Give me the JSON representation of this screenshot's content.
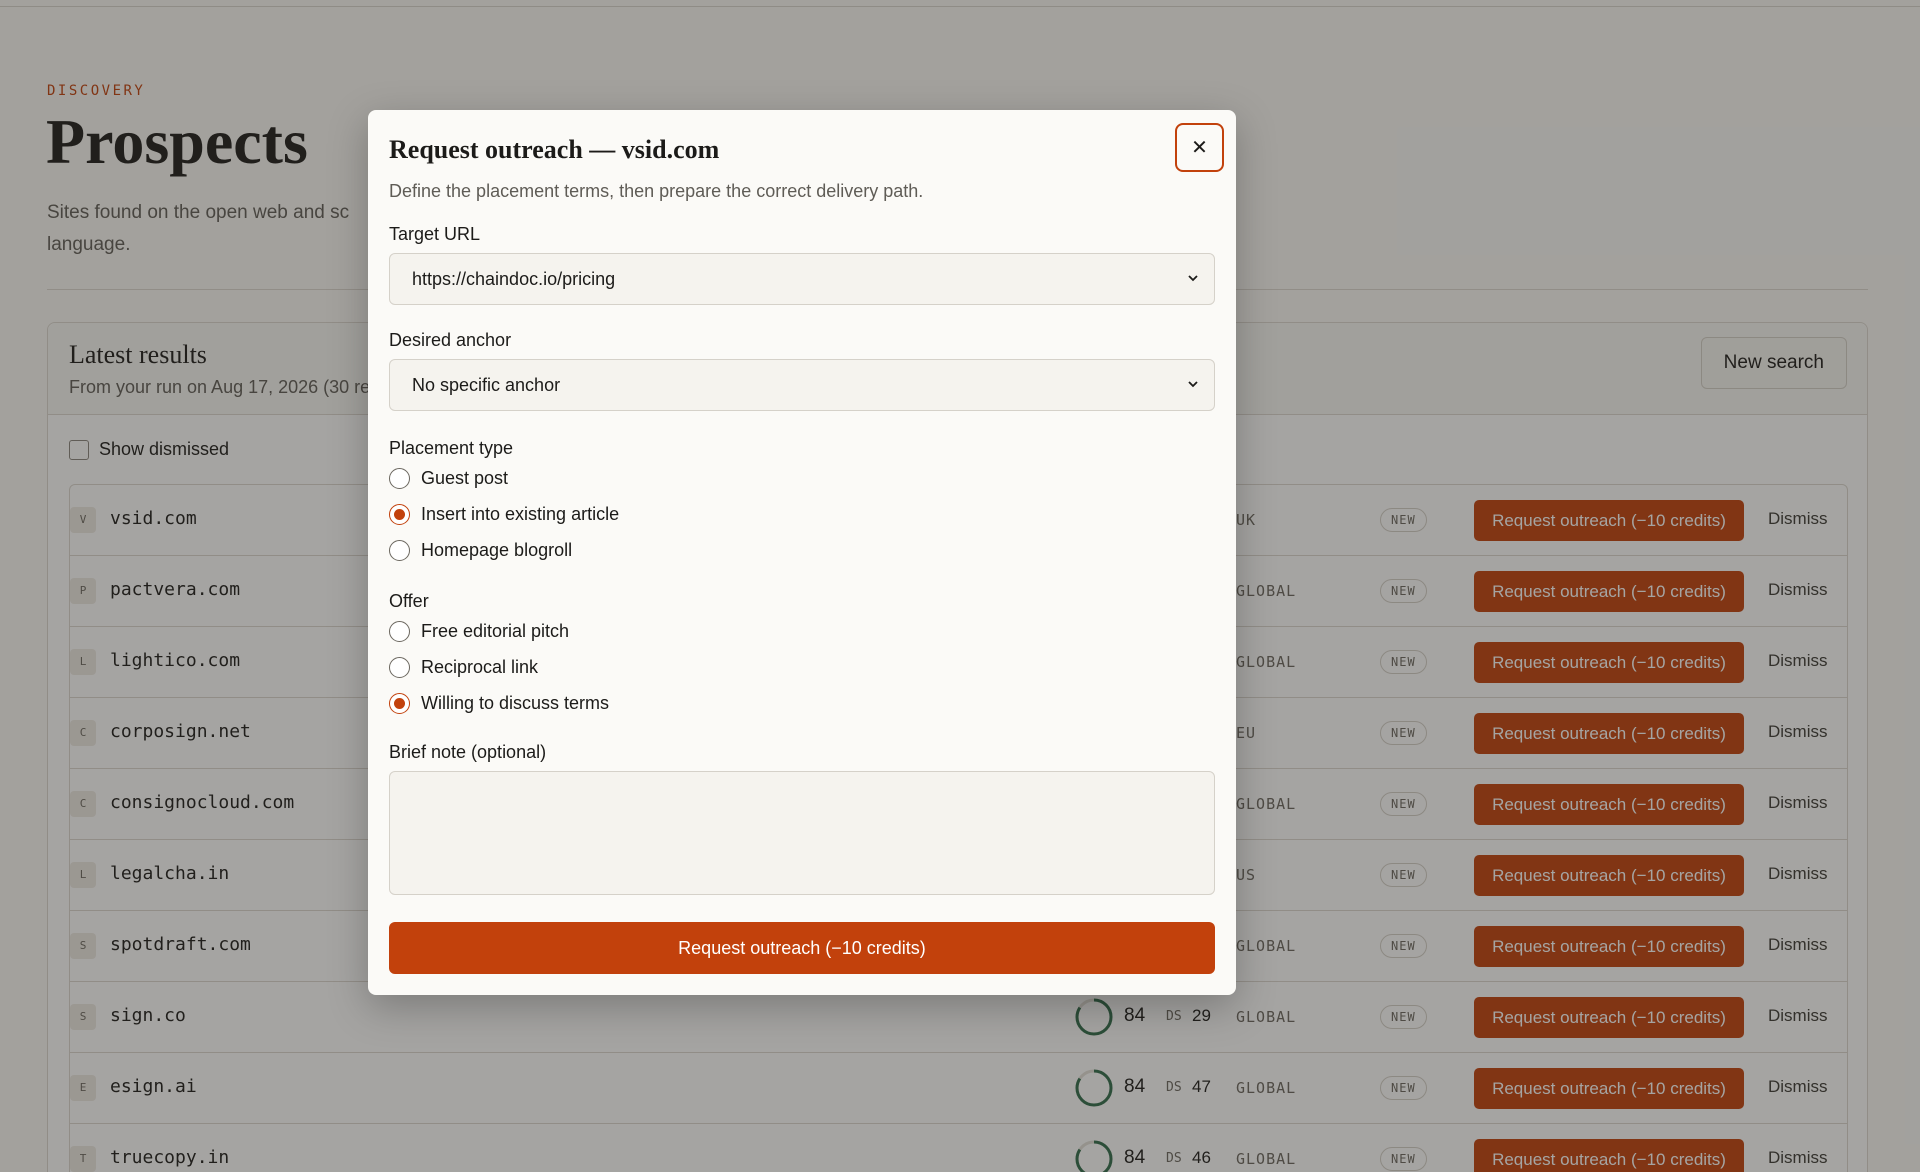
{
  "page": {
    "eyebrow": "DISCOVERY",
    "title": "Prospects",
    "subtitle": "Sites found on the open web and sc language."
  },
  "results": {
    "title": "Latest results",
    "subtitle": "From your run on Aug 17, 2026 (30 re",
    "new_search_label": "New search",
    "show_dismissed_label": "Show dismissed",
    "request_label": "Request outreach (−10 credits)",
    "dismiss_label": "Dismiss",
    "badge_label": "NEW",
    "ds_label": "DS",
    "rows": [
      {
        "initial": "V",
        "domain": "vsid.com",
        "score": "",
        "ds": "",
        "region": "UK"
      },
      {
        "initial": "P",
        "domain": "pactvera.com",
        "score": "",
        "ds": "",
        "region": "GLOBAL"
      },
      {
        "initial": "L",
        "domain": "lightico.com",
        "score": "",
        "ds": "",
        "region": "GLOBAL"
      },
      {
        "initial": "C",
        "domain": "corposign.net",
        "score": "",
        "ds": "",
        "region": "EU"
      },
      {
        "initial": "C",
        "domain": "consignocloud.com",
        "score": "",
        "ds": "",
        "region": "GLOBAL"
      },
      {
        "initial": "L",
        "domain": "legalcha.in",
        "score": "",
        "ds": "",
        "region": "US"
      },
      {
        "initial": "S",
        "domain": "spotdraft.com",
        "score": "",
        "ds": "",
        "region": "GLOBAL"
      },
      {
        "initial": "S",
        "domain": "sign.co",
        "score": "84",
        "ds": "29",
        "region": "GLOBAL"
      },
      {
        "initial": "E",
        "domain": "esign.ai",
        "score": "84",
        "ds": "47",
        "region": "GLOBAL"
      },
      {
        "initial": "T",
        "domain": "truecopy.in",
        "score": "84",
        "ds": "46",
        "region": "GLOBAL"
      }
    ]
  },
  "modal": {
    "title": "Request outreach — vsid.com",
    "description": "Define the placement terms, then prepare the correct delivery path.",
    "close_icon": "close-icon",
    "target_url_label": "Target URL",
    "target_url_value": "https://chaindoc.io/pricing",
    "anchor_label": "Desired anchor",
    "anchor_value": "No specific anchor",
    "placement_label": "Placement type",
    "placement_options": [
      {
        "label": "Guest post",
        "selected": false
      },
      {
        "label": "Insert into existing article",
        "selected": true
      },
      {
        "label": "Homepage blogroll",
        "selected": false
      }
    ],
    "offer_label": "Offer",
    "offer_options": [
      {
        "label": "Free editorial pitch",
        "selected": false
      },
      {
        "label": "Reciprocal link",
        "selected": false
      },
      {
        "label": "Willing to discuss terms",
        "selected": true
      }
    ],
    "note_label": "Brief note (optional)",
    "note_value": "",
    "submit_label": "Request outreach (−10 credits)"
  },
  "colors": {
    "accent": "#c2410c",
    "score_ring": "#2f6b4a"
  }
}
